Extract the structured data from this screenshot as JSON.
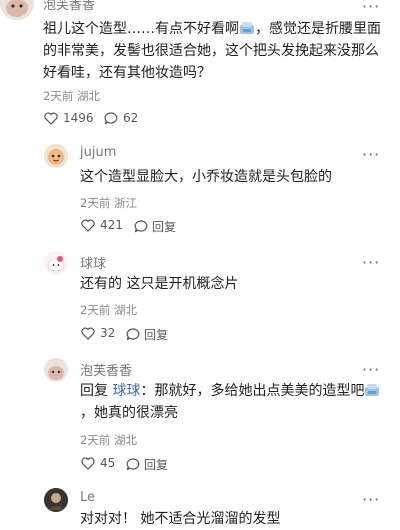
{
  "comments": [
    {
      "name": "泡芙香香",
      "text_parts": [
        "祖儿这个造型……有点不好看啊",
        "，感觉还是折腰里面的非常美，发髻也很适合她，这个把头发挽起来没那么好看哇，还有其他妆造吗？"
      ],
      "time": "2天前",
      "location": "湖北",
      "likes": "1496",
      "replies": "62"
    },
    {
      "name": "jujum",
      "text": "这个造型显脸大，小乔妆造就是头包脸的",
      "time": "2天前",
      "location": "浙江",
      "likes": "421",
      "reply_label": "回复"
    },
    {
      "name": "球球",
      "text": "还有的 这只是开机概念片",
      "time": "2天前",
      "location": "湖北",
      "likes": "32",
      "reply_label": "回复"
    },
    {
      "name": "泡芙香香",
      "reply_prefix": "回复",
      "mention": "球球",
      "text_parts": [
        "：那就好，多给她出点美美的造型吧",
        "，她真的很漂亮"
      ],
      "time": "2天前",
      "location": "湖北",
      "likes": "45",
      "reply_label": "回复"
    },
    {
      "name": "Le",
      "text": "对对对！ 她不适合光溜溜的发型"
    }
  ],
  "more_label": "···",
  "colors": {
    "meta": "#8a8a8a",
    "mention": "#3f6aa6",
    "name": "#7a7a7a"
  }
}
